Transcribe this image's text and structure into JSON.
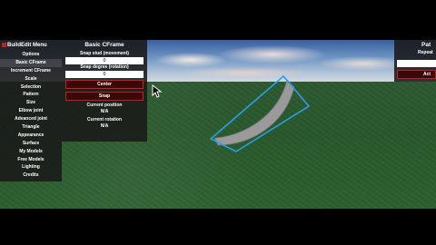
{
  "menu": {
    "title": "BuildEdit Menu",
    "items": [
      {
        "label": "Options",
        "selected": false
      },
      {
        "label": "Basic CFrame",
        "selected": true
      },
      {
        "label": "Increment CFrame",
        "selected": false
      },
      {
        "label": "Scale",
        "selected": false
      },
      {
        "label": "Selection",
        "selected": false
      },
      {
        "label": "Pattern",
        "selected": false
      },
      {
        "label": "Size",
        "selected": false
      },
      {
        "label": "Elbow joint",
        "selected": false
      },
      {
        "label": "Advanced joint",
        "selected": false
      },
      {
        "label": "Triangle",
        "selected": false
      },
      {
        "label": "Appearance",
        "selected": false
      },
      {
        "label": "Surface",
        "selected": false
      },
      {
        "label": "My Models",
        "selected": false
      },
      {
        "label": "Free Models",
        "selected": false
      },
      {
        "label": "Lighting",
        "selected": false
      },
      {
        "label": "Credits",
        "selected": false
      }
    ]
  },
  "cframe": {
    "title": "Basic CFrame",
    "snap_stud_label": "Snap stud (movement)",
    "snap_stud_value": "0",
    "snap_degree_label": "Snap degree (rotation)",
    "snap_degree_value": "0",
    "center_button": "Center",
    "snap_button": "Snap",
    "current_position_label": "Current position",
    "current_position_value": "N/A",
    "current_rotation_label": "Current rotation",
    "current_rotation_value": "N/A"
  },
  "pattern": {
    "title": "Pat",
    "repeat_label": "Repeat",
    "action_button": "Act"
  },
  "colors": {
    "accent_red": "#c02020",
    "selection_blue": "#2a9fe8",
    "ground_green": "#2d6130"
  }
}
